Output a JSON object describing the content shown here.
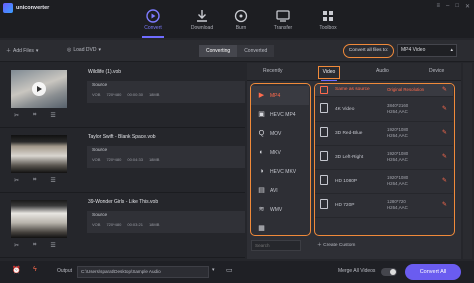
{
  "app": {
    "title": "uniconverter"
  },
  "window_controls": [
    "≡",
    "–",
    "□",
    "✕"
  ],
  "nav": {
    "tabs": [
      {
        "label": "Convert",
        "icon": "convert-icon",
        "active": true
      },
      {
        "label": "Download",
        "icon": "download-icon",
        "active": false
      },
      {
        "label": "Burn",
        "icon": "burn-disc-icon",
        "active": false
      },
      {
        "label": "Transfer",
        "icon": "transfer-icon",
        "active": false
      },
      {
        "label": "Toolbox",
        "icon": "toolbox-icon",
        "active": false
      }
    ]
  },
  "toolbar": {
    "add_files": "Add Files",
    "load_dvd": "Load DVD",
    "seg_converting": "Converting",
    "seg_converted": "Converted",
    "convert_all_label": "Convert all files to:",
    "format_value": "MP4 Video"
  },
  "files": [
    {
      "name": "Wildlife (1).vob",
      "source": "Source",
      "meta": [
        "VOB",
        "720*480",
        "00:00:30",
        "18MB"
      ],
      "thumb": "wildlife"
    },
    {
      "name": "Taylor Swift - Blank Space.vob",
      "source": "Source",
      "meta": [
        "VOB",
        "720*480",
        "00:04:33",
        "18MB"
      ],
      "thumb": "dark"
    },
    {
      "name": "39-Wonder Girls - Like This.vob",
      "source": "Source",
      "meta": [
        "VOB",
        "720*480",
        "00:03:21",
        "18MB"
      ],
      "thumb": "bright"
    }
  ],
  "format_panel": {
    "tabs": [
      "Recently",
      "Video",
      "Audio",
      "Device"
    ],
    "active_tab": "Video",
    "formats": [
      {
        "label": "MP4",
        "icon": "▶",
        "selected": true
      },
      {
        "label": "HEVC MP4",
        "icon": "▣",
        "selected": false
      },
      {
        "label": "MOV",
        "icon": "Q",
        "selected": false
      },
      {
        "label": "MKV",
        "icon": "◐",
        "selected": false
      },
      {
        "label": "HEVC MKV",
        "icon": "◑",
        "selected": false
      },
      {
        "label": "AVI",
        "icon": "▤",
        "selected": false
      },
      {
        "label": "WMV",
        "icon": "≋",
        "selected": false
      },
      {
        "label": "",
        "icon": "▦",
        "selected": false
      }
    ],
    "search_placeholder": "Search",
    "resolutions": [
      {
        "name": "Same as source",
        "spec1": "Original Resolution",
        "spec2": ""
      },
      {
        "name": "4K Video",
        "spec1": "3840*2160",
        "spec2": "H264,AAC"
      },
      {
        "name": "3D Red-Blue",
        "spec1": "1920*1080",
        "spec2": "H264,AAC"
      },
      {
        "name": "3D Left-Right",
        "spec1": "1920*1080",
        "spec2": "H264,AAC"
      },
      {
        "name": "HD 1080P",
        "spec1": "1920*1080",
        "spec2": "H264,AAC"
      },
      {
        "name": "HD 720P",
        "spec1": "1280*720",
        "spec2": "H264,AAC"
      }
    ],
    "create_custom": "Create Custom"
  },
  "bottom": {
    "output_label": "Output",
    "output_path": "C:\\Users\\sparat\\Desktop\\Sample Audio",
    "merge_label": "Merge All Videos",
    "convert_all": "Convert All"
  },
  "colors": {
    "accent": "#6a5cf0",
    "highlight": "#f08a3a",
    "selected_text": "#ff6b4d"
  }
}
